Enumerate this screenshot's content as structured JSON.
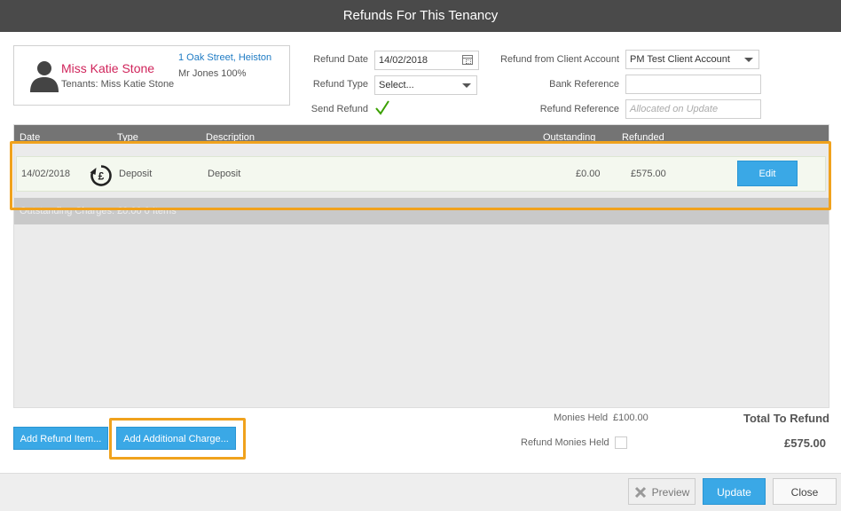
{
  "window": {
    "title": "Refunds For This Tenancy"
  },
  "tenant": {
    "name": "Miss Katie Stone",
    "tenants_line": "Tenants: Miss Katie Stone",
    "address": "1 Oak Street, Heiston",
    "owner": "Mr Jones 100%"
  },
  "form": {
    "refund_date_label": "Refund Date",
    "refund_date_value": "14/02/2018",
    "refund_type_label": "Refund Type",
    "refund_type_value": "Select...",
    "send_refund_label": "Send Refund",
    "client_account_label": "Refund from Client Account",
    "client_account_value": "PM Test Client Account",
    "bank_reference_label": "Bank Reference",
    "bank_reference_value": "",
    "refund_reference_label": "Refund Reference",
    "refund_reference_placeholder": "Allocated on Update"
  },
  "grid": {
    "columns": [
      "Date",
      "Type",
      "Description",
      "Outstanding",
      "Refunded"
    ],
    "rows": [
      {
        "date": "14/02/2018",
        "type": "Deposit",
        "description": "Deposit",
        "outstanding": "£0.00",
        "refunded": "£575.00",
        "action": "Edit"
      }
    ],
    "footer_text": "Outstanding Charges: £0.00 0 Items"
  },
  "actions": {
    "add_refund_item": "Add Refund Item...",
    "add_additional_charge": "Add Additional Charge..."
  },
  "summary": {
    "monies_held_label": "Monies Held",
    "monies_held_value": "£100.00",
    "refund_monies_held_label": "Refund Monies Held",
    "total_label": "Total To Refund",
    "total_value": "£575.00"
  },
  "footer": {
    "preview": "Preview",
    "update": "Update",
    "close": "Close"
  },
  "colors": {
    "accent": "#3aa8e6",
    "highlight": "#f0a21d",
    "tenant_name": "#d0245b",
    "link": "#1e7bc4"
  }
}
